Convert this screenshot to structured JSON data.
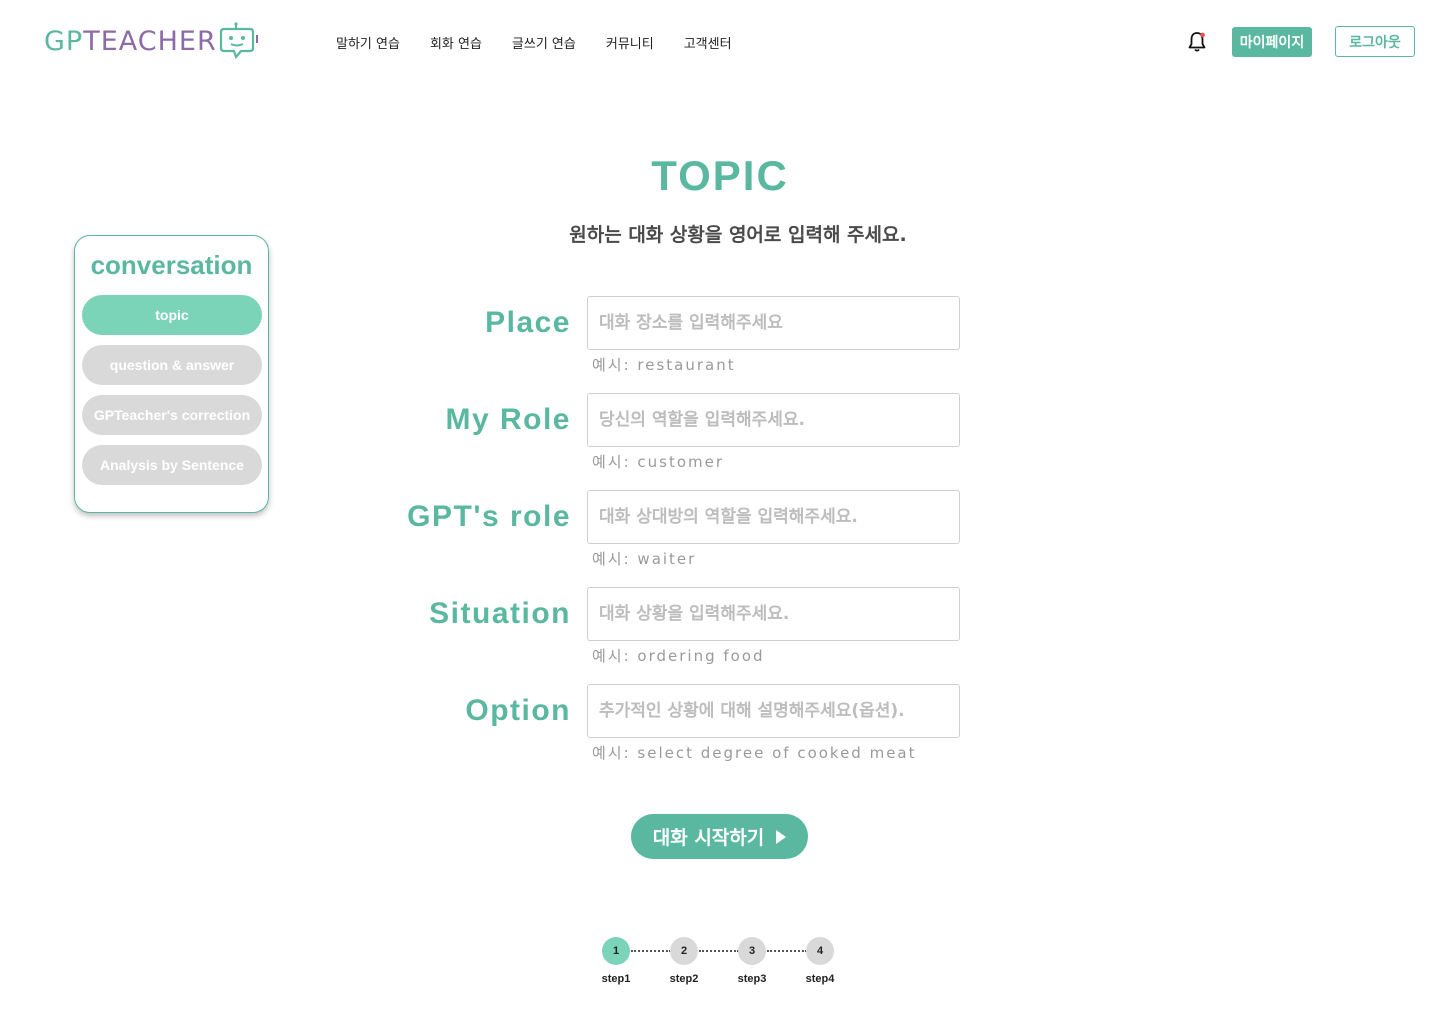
{
  "header": {
    "logo_text_part1": "GP",
    "logo_text_part2": "TEACHER",
    "nav": [
      "말하기 연습",
      "회화 연습",
      "글쓰기 연습",
      "커뮤니티",
      "고객센터"
    ],
    "mypage_label": "마이페이지",
    "logout_label": "로그아웃"
  },
  "sidebar": {
    "title": "conversation",
    "items": [
      {
        "label": "topic",
        "active": true
      },
      {
        "label": "question & answer",
        "active": false
      },
      {
        "label": "GPTeacher's correction",
        "active": false
      },
      {
        "label": "Analysis by Sentence",
        "active": false
      }
    ]
  },
  "main": {
    "title": "TOPIC",
    "subtitle": "원하는 대화 상황을 영어로 입력해 주세요.",
    "fields": [
      {
        "label": "Place",
        "value": "",
        "placeholder": "대화 장소를 입력해주세요",
        "hint": "예시: restaurant"
      },
      {
        "label": "My Role",
        "value": "",
        "placeholder": "당신의 역할을 입력해주세요.",
        "hint": "예시: customer"
      },
      {
        "label": "GPT's role",
        "value": "",
        "placeholder": "대화 상대방의 역할을 입력해주세요.",
        "hint": "예시: waiter"
      },
      {
        "label": "Situation",
        "value": "",
        "placeholder": "대화 상황을 입력해주세요.",
        "hint": "예시: ordering food"
      },
      {
        "label": "Option",
        "value": "",
        "placeholder": "추가적인 상황에 대해 설명해주세요(옵션).",
        "hint": "예시: select degree of cooked meat"
      }
    ],
    "start_label": "대화 시작하기"
  },
  "stepper": {
    "current": 1,
    "steps": [
      {
        "number": "1",
        "label": "step1"
      },
      {
        "number": "2",
        "label": "step2"
      },
      {
        "number": "3",
        "label": "step3"
      },
      {
        "number": "4",
        "label": "step4"
      }
    ]
  },
  "colors": {
    "accent": "#5ab8a0",
    "accent_light": "#7bd3b8",
    "logo_purple": "#8d6aa8",
    "inactive": "#d9d9d9",
    "notification_dot": "#e05555"
  },
  "icons": {
    "bell": "bell-icon",
    "play": "play-icon",
    "logo_robot": "robot-chat-icon"
  }
}
